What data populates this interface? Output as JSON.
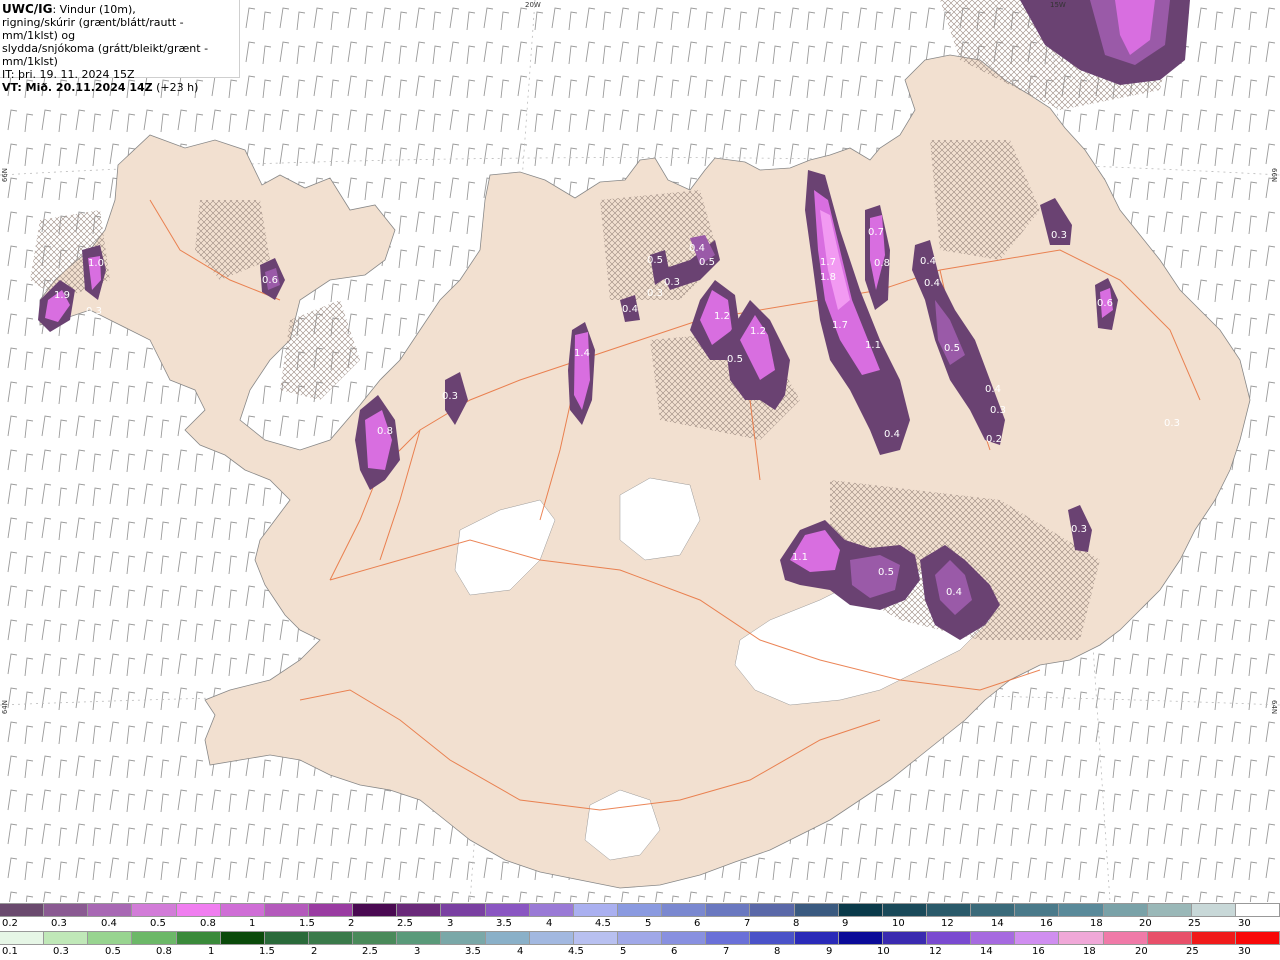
{
  "header": {
    "model": "UWC/IG",
    "description": ": Vindur (10m), rigning/skúrir (grænt/blátt/rautt - mm/1klst) og slydda/snjókoma (grátt/bleikt/grænt - mm/1klst)",
    "line1": ": Vindur (10m),",
    "line2": "rigning/skúrir (grænt/blátt/rautt - mm/1klst) og",
    "line3": "slydda/snjókoma (grátt/bleikt/grænt - mm/1klst)",
    "init_time": "IT: þri. 19. 11. 2024 15Z",
    "valid_time": "VT: Mið. 20.11.2024 14Z",
    "valid_offset": " (+23 h)"
  },
  "grid_labels": {
    "lon_20w": "20W",
    "lon_15w": "15W",
    "lat_66n_left": "66N",
    "lat_66n_right": "66N",
    "lat_64n_left": "64N",
    "lat_64n_right": "64N"
  },
  "colors": {
    "land": "#f2e0d0",
    "sea": "#ffffff",
    "roads": "#e8703a",
    "precip_light": "#6a4272",
    "precip_mid": "#9a5aa8",
    "precip_high": "#d86ee0",
    "precip_peak": "#f29af2"
  },
  "precip_values": [
    {
      "id": "westfjords-1",
      "label": "1.0"
    },
    {
      "id": "westfjords-2",
      "label": "1.9"
    },
    {
      "id": "westfjords-3",
      "label": "0.3"
    },
    {
      "id": "westfjords-4",
      "label": "0.6"
    },
    {
      "id": "snaefells",
      "label": "0.8"
    },
    {
      "id": "west-north",
      "label": "0.3"
    },
    {
      "id": "skagi",
      "label": "1.4"
    },
    {
      "id": "tr-1",
      "label": "0.4"
    },
    {
      "id": "tr-2",
      "label": "0.5"
    },
    {
      "id": "tr-3",
      "label": "0.3"
    },
    {
      "id": "tr-4",
      "label": "0.5"
    },
    {
      "id": "tr-5",
      "label": "0.3"
    },
    {
      "id": "tr-6",
      "label": "0.4"
    },
    {
      "id": "eyja-1",
      "label": "1.2"
    },
    {
      "id": "eyja-2",
      "label": "1.2"
    },
    {
      "id": "eyja-3",
      "label": "0.5"
    },
    {
      "id": "ne-1",
      "label": "1.7"
    },
    {
      "id": "ne-2",
      "label": "1.8"
    },
    {
      "id": "ne-3",
      "label": "1.7"
    },
    {
      "id": "ne-4",
      "label": "0.7"
    },
    {
      "id": "ne-5",
      "label": "0.8"
    },
    {
      "id": "ne-6",
      "label": "1.1"
    },
    {
      "id": "ne-7",
      "label": "0.4"
    },
    {
      "id": "ne-8",
      "label": "0.4"
    },
    {
      "id": "ne-9",
      "label": "0.4"
    },
    {
      "id": "ne-10",
      "label": "0.5"
    },
    {
      "id": "ne-11",
      "label": "0.4"
    },
    {
      "id": "ne-12",
      "label": "0.3"
    },
    {
      "id": "ne-13",
      "label": "0.2"
    },
    {
      "id": "east-1",
      "label": "0.3"
    },
    {
      "id": "east-2",
      "label": "0.6"
    },
    {
      "id": "east-3",
      "label": "0.3"
    },
    {
      "id": "vatna-1",
      "label": "1.1"
    },
    {
      "id": "vatna-2",
      "label": "0.5"
    },
    {
      "id": "vatna-3",
      "label": "0.4"
    },
    {
      "id": "se-1",
      "label": "0.3"
    }
  ],
  "legend_top": {
    "colors": [
      "#6a4a6e",
      "#8a5a92",
      "#a868b4",
      "#d27cd8",
      "#f07ef0",
      "#cf6ed6",
      "#b45abc",
      "#9a3ca2",
      "#4a0a52",
      "#6a2a7a",
      "#7a40a2",
      "#8a56c2",
      "#9a7ad6",
      "#aab0f0",
      "#8a9ae0",
      "#7a88d0",
      "#6a78c0",
      "#5a68a8",
      "#3a5a80",
      "#0a3a4a",
      "#1a4a5a",
      "#2a5a6a",
      "#3a6a7a",
      "#4a7a8a",
      "#5a8a9a",
      "#7aa2a8",
      "#9ab8b8",
      "#c8d8d8",
      "#ffffff"
    ],
    "labels": [
      "0.2",
      "0.3",
      "0.4",
      "0.5",
      "0.8",
      "1",
      "1.5",
      "2",
      "2.5",
      "3",
      "3.5",
      "4",
      "4.5",
      "5",
      "6",
      "7",
      "8",
      "9",
      "10",
      "12",
      "14",
      "16",
      "18",
      "20",
      "25",
      "30"
    ]
  },
  "legend_bottom": {
    "colors": [
      "#e6f6e6",
      "#c0e8b8",
      "#98d490",
      "#6cb868",
      "#3a8a3a",
      "#0a4a0a",
      "#2a6a3a",
      "#3a7a4a",
      "#4a8a5a",
      "#5a9a7a",
      "#7aa8a8",
      "#8ab0c8",
      "#a2b8e0",
      "#b8c0f0",
      "#a0a8e8",
      "#8890e0",
      "#6a70d8",
      "#4a52c8",
      "#2a2ab8",
      "#0a0a98",
      "#3a2ab0",
      "#7a4ad0",
      "#a66ae0",
      "#d08ef0",
      "#f0a8d8",
      "#f07aa8",
      "#e8506a",
      "#f01a1a",
      "#f80808"
    ],
    "labels": [
      "0.1",
      "0.3",
      "0.5",
      "0.8",
      "1",
      "1.5",
      "2",
      "2.5",
      "3",
      "3.5",
      "4",
      "4.5",
      "5",
      "6",
      "7",
      "8",
      "9",
      "10",
      "12",
      "14",
      "16",
      "18",
      "20",
      "25",
      "30"
    ]
  }
}
